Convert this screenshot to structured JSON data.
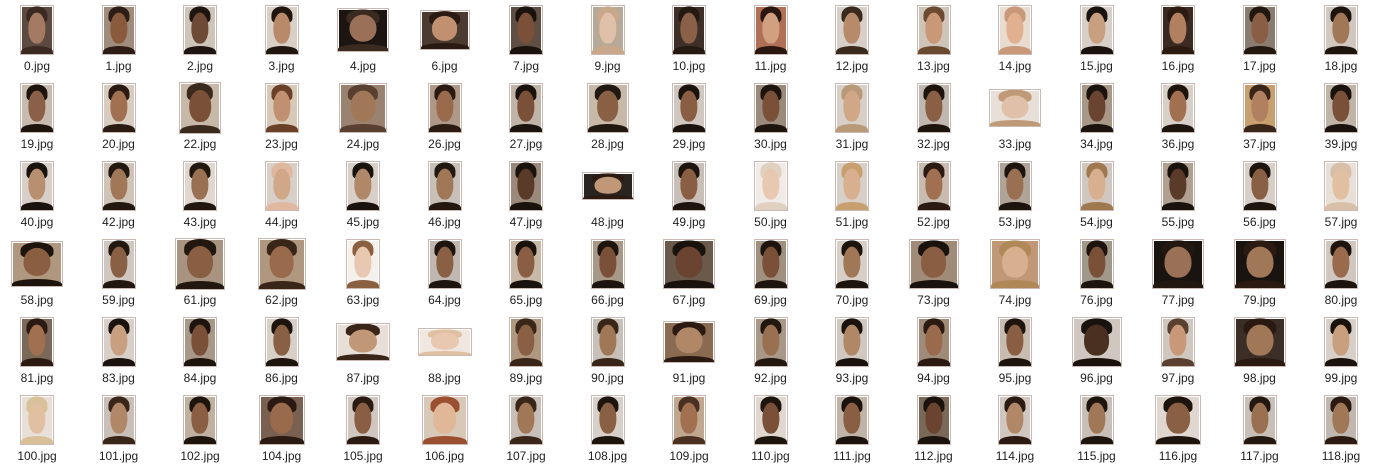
{
  "files": [
    {
      "name": "0.jpg",
      "skin": "#a57a62",
      "hair": "#3a2a22",
      "bg": "#5c4a40"
    },
    {
      "name": "1.jpg",
      "skin": "#8a5a3c",
      "hair": "#2c1e16",
      "bg": "#a08c7c"
    },
    {
      "name": "2.jpg",
      "skin": "#6e4a36",
      "hair": "#1e1510",
      "bg": "#cfc4b8"
    },
    {
      "name": "3.jpg",
      "skin": "#b88a6a",
      "hair": "#20160f",
      "bg": "#d8cfc6"
    },
    {
      "name": "4.jpg",
      "skin": "#9a7058",
      "hair": "#3b2a20",
      "bg": "#1c1512"
    },
    {
      "name": "6.jpg",
      "skin": "#c09070",
      "hair": "#2a1a12",
      "bg": "#4a3a30"
    },
    {
      "name": "7.jpg",
      "skin": "#7a5038",
      "hair": "#1a120c",
      "bg": "#5e4e44"
    },
    {
      "name": "9.jpg",
      "skin": "#e0c0a8",
      "hair": "#c8a888",
      "bg": "#b8a898"
    },
    {
      "name": "10.jpg",
      "skin": "#8a6048",
      "hair": "#251a12",
      "bg": "#3e3028"
    },
    {
      "name": "11.jpg",
      "skin": "#d0a080",
      "hair": "#2a1810",
      "bg": "#b07058"
    },
    {
      "name": "12.jpg",
      "skin": "#b88a6c",
      "hair": "#3a2a1e",
      "bg": "#d8d0c8"
    },
    {
      "name": "13.jpg",
      "skin": "#c89878",
      "hair": "#6a4a30",
      "bg": "#cfc4b8"
    },
    {
      "name": "14.jpg",
      "skin": "#e0b090",
      "hair": "#c89878",
      "bg": "#e8dcd0"
    },
    {
      "name": "15.jpg",
      "skin": "#c8a080",
      "hair": "#1a120c",
      "bg": "#d8d0c8"
    },
    {
      "name": "16.jpg",
      "skin": "#b08060",
      "hair": "#2a1a10",
      "bg": "#3a2a22"
    },
    {
      "name": "17.jpg",
      "skin": "#8a5e44",
      "hair": "#221810",
      "bg": "#8a7c70"
    },
    {
      "name": "18.jpg",
      "skin": "#a07858",
      "hair": "#1e140e",
      "bg": "#d0c8c0"
    },
    {
      "name": "19.jpg",
      "skin": "#8a6048",
      "hair": "#1e140e",
      "bg": "#c8bcb0"
    },
    {
      "name": "20.jpg",
      "skin": "#a07050",
      "hair": "#2a1a12",
      "bg": "#d8ccc0"
    },
    {
      "name": "22.jpg",
      "skin": "#7a5038",
      "hair": "#3a2a1e",
      "bg": "#c8b8a8"
    },
    {
      "name": "23.jpg",
      "skin": "#c09070",
      "hair": "#6a4028",
      "bg": "#d8c8b8"
    },
    {
      "name": "24.jpg",
      "skin": "#a07858",
      "hair": "#5a4030",
      "bg": "#9a8270"
    },
    {
      "name": "26.jpg",
      "skin": "#9a6a4c",
      "hair": "#2a1a12",
      "bg": "#b09888"
    },
    {
      "name": "27.jpg",
      "skin": "#7a5038",
      "hair": "#1a120c",
      "bg": "#c0b4a8"
    },
    {
      "name": "28.jpg",
      "skin": "#8a6044",
      "hair": "#221812",
      "bg": "#c8b8a8"
    },
    {
      "name": "29.jpg",
      "skin": "#8a5e42",
      "hair": "#1a120c",
      "bg": "#d0c8c0"
    },
    {
      "name": "30.jpg",
      "skin": "#7a5038",
      "hair": "#1e140e",
      "bg": "#9a8a7c"
    },
    {
      "name": "31.jpg",
      "skin": "#d0a888",
      "hair": "#b89a78",
      "bg": "#d8d0c8"
    },
    {
      "name": "32.jpg",
      "skin": "#8a6044",
      "hair": "#1e140e",
      "bg": "#c0b8b0"
    },
    {
      "name": "33.jpg",
      "skin": "#e0c0a8",
      "hair": "#c09a78",
      "bg": "#e8e0d8"
    },
    {
      "name": "34.jpg",
      "skin": "#6a4430",
      "hair": "#1a120c",
      "bg": "#a89888"
    },
    {
      "name": "36.jpg",
      "skin": "#a07050",
      "hair": "#1e140e",
      "bg": "#d8d0c8"
    },
    {
      "name": "37.jpg",
      "skin": "#b08060",
      "hair": "#3a2618",
      "bg": "#c8a070"
    },
    {
      "name": "39.jpg",
      "skin": "#7a5038",
      "hair": "#1a120c",
      "bg": "#c0b4a8"
    },
    {
      "name": "40.jpg",
      "skin": "#b89070",
      "hair": "#1a120c",
      "bg": "#d8d0c8"
    },
    {
      "name": "42.jpg",
      "skin": "#a07858",
      "hair": "#221810",
      "bg": "#d0c4b8"
    },
    {
      "name": "43.jpg",
      "skin": "#9a7052",
      "hair": "#221810",
      "bg": "#e0d8d0"
    },
    {
      "name": "44.jpg",
      "skin": "#d0a888",
      "hair": "#e0b8a0",
      "bg": "#d8d0c8"
    },
    {
      "name": "45.jpg",
      "skin": "#b08868",
      "hair": "#1a120c",
      "bg": "#d8d0c8"
    },
    {
      "name": "46.jpg",
      "skin": "#a07858",
      "hair": "#221810",
      "bg": "#c8c0b8"
    },
    {
      "name": "47.jpg",
      "skin": "#5a3a28",
      "hair": "#1a120c",
      "bg": "#9a8a7c"
    },
    {
      "name": "48.jpg",
      "skin": "#c09878",
      "hair": "#2a1a12",
      "bg": "#2a2420"
    },
    {
      "name": "49.jpg",
      "skin": "#8a5e42",
      "hair": "#1e140e",
      "bg": "#c8c0b8"
    },
    {
      "name": "50.jpg",
      "skin": "#e8c8b0",
      "hair": "#e0d0c0",
      "bg": "#f0ebe6"
    },
    {
      "name": "51.jpg",
      "skin": "#d8b090",
      "hair": "#c8a070",
      "bg": "#d8d0c8"
    },
    {
      "name": "52.jpg",
      "skin": "#a07050",
      "hair": "#2a1a12",
      "bg": "#c8bcb0"
    },
    {
      "name": "53.jpg",
      "skin": "#9a7052",
      "hair": "#1e140e",
      "bg": "#b0a498"
    },
    {
      "name": "54.jpg",
      "skin": "#d8b090",
      "hair": "#a07850",
      "bg": "#d0c8c0"
    },
    {
      "name": "55.jpg",
      "skin": "#5a3a28",
      "hair": "#1a120c",
      "bg": "#b0a090"
    },
    {
      "name": "56.jpg",
      "skin": "#8a6044",
      "hair": "#1e140e",
      "bg": "#d8d0c8"
    },
    {
      "name": "57.jpg",
      "skin": "#e0c0a0",
      "hair": "#d8c0a8",
      "bg": "#e8e0d8"
    },
    {
      "name": "58.jpg",
      "skin": "#8a5e40",
      "hair": "#1e140e",
      "bg": "#b09880"
    },
    {
      "name": "59.jpg",
      "skin": "#8a6044",
      "hair": "#221810",
      "bg": "#d0c8c0"
    },
    {
      "name": "61.jpg",
      "skin": "#8a5e42",
      "hair": "#221810",
      "bg": "#a89480"
    },
    {
      "name": "62.jpg",
      "skin": "#9a6a4c",
      "hair": "#3a2618",
      "bg": "#b09880"
    },
    {
      "name": "63.jpg",
      "skin": "#e8c8b0",
      "hair": "#8a6040",
      "bg": "#f4f0ec"
    },
    {
      "name": "64.jpg",
      "skin": "#8a6044",
      "hair": "#1e140e",
      "bg": "#c0b8b0"
    },
    {
      "name": "65.jpg",
      "skin": "#8a5e42",
      "hair": "#1a120c",
      "bg": "#c8b8a8"
    },
    {
      "name": "66.jpg",
      "skin": "#7a5038",
      "hair": "#1e140e",
      "bg": "#a89888"
    },
    {
      "name": "67.jpg",
      "skin": "#6a4430",
      "hair": "#1a120c",
      "bg": "#6a5a4c"
    },
    {
      "name": "69.jpg",
      "skin": "#7a5038",
      "hair": "#1e140e",
      "bg": "#a09080"
    },
    {
      "name": "70.jpg",
      "skin": "#a07858",
      "hair": "#1e140e",
      "bg": "#d8d0c8"
    },
    {
      "name": "73.jpg",
      "skin": "#8a5e42",
      "hair": "#1a120c",
      "bg": "#a08a78"
    },
    {
      "name": "74.jpg",
      "skin": "#d8b090",
      "hair": "#b08858",
      "bg": "#c09878"
    },
    {
      "name": "76.jpg",
      "skin": "#7a5038",
      "hair": "#1e140e",
      "bg": "#a09888"
    },
    {
      "name": "77.jpg",
      "skin": "#9a7056",
      "hair": "#221810",
      "bg": "#1a1410"
    },
    {
      "name": "79.jpg",
      "skin": "#a07858",
      "hair": "#2a1a12",
      "bg": "#1a1410"
    },
    {
      "name": "80.jpg",
      "skin": "#9a6a4c",
      "hair": "#1e140e",
      "bg": "#d0c8c0"
    },
    {
      "name": "81.jpg",
      "skin": "#a07050",
      "hair": "#2a1a12",
      "bg": "#7a6858"
    },
    {
      "name": "83.jpg",
      "skin": "#c8a080",
      "hair": "#1a120c",
      "bg": "#d8d0c8"
    },
    {
      "name": "84.jpg",
      "skin": "#7a5038",
      "hair": "#1e140e",
      "bg": "#a89888"
    },
    {
      "name": "86.jpg",
      "skin": "#8a6044",
      "hair": "#1e140e",
      "bg": "#d8d0c8"
    },
    {
      "name": "87.jpg",
      "skin": "#c09878",
      "hair": "#3a2618",
      "bg": "#e8e0d8"
    },
    {
      "name": "88.jpg",
      "skin": "#e8c8b0",
      "hair": "#e0c0a0",
      "bg": "#f0e8e0"
    },
    {
      "name": "89.jpg",
      "skin": "#8a6044",
      "hair": "#3a2618",
      "bg": "#b09880"
    },
    {
      "name": "90.jpg",
      "skin": "#a07858",
      "hair": "#3a2618",
      "bg": "#c8c0b8"
    },
    {
      "name": "91.jpg",
      "skin": "#b08868",
      "hair": "#2a1a12",
      "bg": "#8a6a50"
    },
    {
      "name": "92.jpg",
      "skin": "#9a7052",
      "hair": "#221810",
      "bg": "#a89888"
    },
    {
      "name": "93.jpg",
      "skin": "#b08868",
      "hair": "#1a120c",
      "bg": "#d0c8c0"
    },
    {
      "name": "94.jpg",
      "skin": "#9a6a4c",
      "hair": "#2a1a12",
      "bg": "#a08a78"
    },
    {
      "name": "95.jpg",
      "skin": "#8a5e42",
      "hair": "#1e140e",
      "bg": "#c8bcb0"
    },
    {
      "name": "96.jpg",
      "skin": "#4a3020",
      "hair": "#1a120c",
      "bg": "#d0c8c0"
    },
    {
      "name": "97.jpg",
      "skin": "#c89878",
      "hair": "#5a4030",
      "bg": "#d0c8c0"
    },
    {
      "name": "98.jpg",
      "skin": "#a07858",
      "hair": "#2a1a12",
      "bg": "#3a2e26"
    },
    {
      "name": "99.jpg",
      "skin": "#c8a080",
      "hair": "#1a120c",
      "bg": "#d8d0c8"
    },
    {
      "name": "100.jpg",
      "skin": "#e0c0a0",
      "hair": "#d8c098",
      "bg": "#e8e0d8"
    },
    {
      "name": "101.jpg",
      "skin": "#b08868",
      "hair": "#3a2618",
      "bg": "#c8c0b8"
    },
    {
      "name": "102.jpg",
      "skin": "#8a5e42",
      "hair": "#1e140e",
      "bg": "#c0b0a0"
    },
    {
      "name": "104.jpg",
      "skin": "#9a6a4c",
      "hair": "#2a1a12",
      "bg": "#7a6050"
    },
    {
      "name": "105.jpg",
      "skin": "#8a5e42",
      "hair": "#2a1a12",
      "bg": "#d0c8c0"
    },
    {
      "name": "106.jpg",
      "skin": "#e0b898",
      "hair": "#9a5030",
      "bg": "#d8c8b8"
    },
    {
      "name": "107.jpg",
      "skin": "#a07858",
      "hair": "#3a2618",
      "bg": "#c8c0b8"
    },
    {
      "name": "108.jpg",
      "skin": "#8a6044",
      "hair": "#1e140e",
      "bg": "#d8d0c8"
    },
    {
      "name": "109.jpg",
      "skin": "#a07050",
      "hair": "#4a3020",
      "bg": "#c0a890"
    },
    {
      "name": "110.jpg",
      "skin": "#7a5038",
      "hair": "#1e140e",
      "bg": "#e0d8d0"
    },
    {
      "name": "111.jpg",
      "skin": "#8a5e42",
      "hair": "#1a120c",
      "bg": "#c0b4a8"
    },
    {
      "name": "112.jpg",
      "skin": "#6a4430",
      "hair": "#1a120c",
      "bg": "#7a6858"
    },
    {
      "name": "114.jpg",
      "skin": "#b08868",
      "hair": "#2a1a12",
      "bg": "#d0c8c0"
    },
    {
      "name": "115.jpg",
      "skin": "#a07858",
      "hair": "#1e140e",
      "bg": "#c8c0b8"
    },
    {
      "name": "116.jpg",
      "skin": "#8a6044",
      "hair": "#1e140e",
      "bg": "#e0d8d0"
    },
    {
      "name": "117.jpg",
      "skin": "#9a7052",
      "hair": "#221810",
      "bg": "#c8c0b8"
    },
    {
      "name": "118.jpg",
      "skin": "#a07858",
      "hair": "#2a1a12",
      "bg": "#c0b8b0"
    }
  ]
}
